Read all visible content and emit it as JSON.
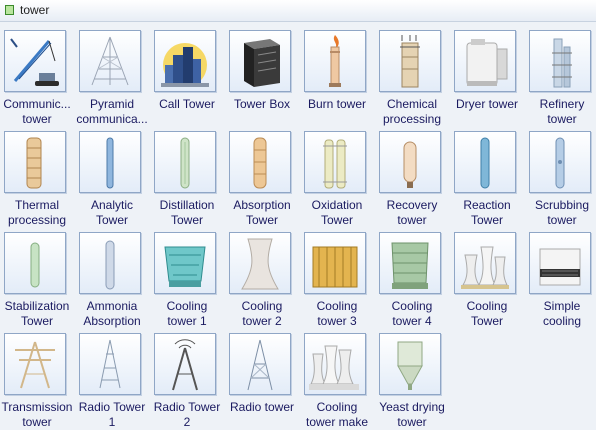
{
  "window": {
    "title": "tower"
  },
  "items": [
    {
      "name": "communication-tower",
      "line1": "Communic...",
      "line2": "tower",
      "icon": "crane-icon"
    },
    {
      "name": "pyramid-communication",
      "line1": "Pyramid",
      "line2": "communica...",
      "icon": "pyramid-mast-icon"
    },
    {
      "name": "call-tower",
      "line1": "Call Tower",
      "line2": "",
      "icon": "city-tower-icon"
    },
    {
      "name": "tower-box",
      "line1": "Tower Box",
      "line2": "",
      "icon": "server-box-icon"
    },
    {
      "name": "burn-tower",
      "line1": "Burn tower",
      "line2": "",
      "icon": "flare-stack-icon"
    },
    {
      "name": "chemical-processing",
      "line1": "Chemical",
      "line2": "processing",
      "icon": "chemical-tower-icon"
    },
    {
      "name": "dryer-tower",
      "line1": "Dryer tower",
      "line2": "",
      "icon": "dryer-tower-icon"
    },
    {
      "name": "refinery-tower",
      "line1": "Refinery",
      "line2": "tower",
      "icon": "refinery-tower-icon"
    },
    {
      "name": "thermal-processing",
      "line1": "Thermal",
      "line2": "processing",
      "icon": "thermal-column-icon"
    },
    {
      "name": "analytic-tower",
      "line1": "Analytic",
      "line2": "Tower",
      "icon": "analytic-column-icon"
    },
    {
      "name": "distillation-tower",
      "line1": "Distillation",
      "line2": "Tower",
      "icon": "distillation-column-icon"
    },
    {
      "name": "absorption-tower",
      "line1": "Absorption",
      "line2": "Tower",
      "icon": "absorption-column-icon"
    },
    {
      "name": "oxidation-tower",
      "line1": "Oxidation",
      "line2": "Tower",
      "icon": "oxidation-column-icon"
    },
    {
      "name": "recovery-tower",
      "line1": "Recovery",
      "line2": "tower",
      "icon": "recovery-vessel-icon"
    },
    {
      "name": "reaction-tower",
      "line1": "Reaction",
      "line2": "Tower",
      "icon": "reaction-column-icon"
    },
    {
      "name": "scrubbing-tower",
      "line1": "Scrubbing",
      "line2": "tower",
      "icon": "scrubbing-column-icon"
    },
    {
      "name": "stabilization-tower",
      "line1": "Stabilization",
      "line2": "Tower",
      "icon": "stabilization-column-icon"
    },
    {
      "name": "ammonia-absorption",
      "line1": "Ammonia",
      "line2": "Absorption",
      "icon": "ammonia-column-icon"
    },
    {
      "name": "cooling-tower-1",
      "line1": "Cooling",
      "line2": "tower 1",
      "icon": "cooling-tower-round-icon"
    },
    {
      "name": "cooling-tower-2",
      "line1": "Cooling",
      "line2": "tower 2",
      "icon": "hyperbolic-tower-icon"
    },
    {
      "name": "cooling-tower-3",
      "line1": "Cooling",
      "line2": "tower 3",
      "icon": "cooling-tower-box-icon"
    },
    {
      "name": "cooling-tower-4",
      "line1": "Cooling",
      "line2": "tower 4",
      "icon": "cooling-tower-green-icon"
    },
    {
      "name": "cooling-tower",
      "line1": "Cooling",
      "line2": "Tower",
      "icon": "cooling-tower-group-icon"
    },
    {
      "name": "simple-cooling",
      "line1": "Simple",
      "line2": "cooling",
      "icon": "simple-cooling-unit-icon"
    },
    {
      "name": "transmission-tower",
      "line1": "Transmission",
      "line2": "tower",
      "icon": "transmission-pylon-icon"
    },
    {
      "name": "radio-tower-1",
      "line1": "Radio Tower",
      "line2": "1",
      "icon": "radio-mast-icon"
    },
    {
      "name": "radio-tower-2",
      "line1": "Radio Tower",
      "line2": "2",
      "icon": "radio-antenna-icon"
    },
    {
      "name": "radio-tower",
      "line1": "Radio tower",
      "line2": "",
      "icon": "radio-lattice-icon"
    },
    {
      "name": "cooling-tower-make",
      "line1": "Cooling",
      "line2": "tower make",
      "icon": "cooling-tower-cluster-icon"
    },
    {
      "name": "yeast-drying-tower",
      "line1": "Yeast drying",
      "line2": "tower",
      "icon": "yeast-drying-tower-icon"
    }
  ]
}
